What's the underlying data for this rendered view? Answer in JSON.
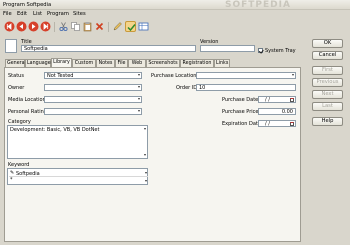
{
  "window": {
    "title": "Program Softpedia"
  },
  "menu": [
    "File",
    "Edit",
    "List",
    "Program",
    "Sites"
  ],
  "toolbar": {
    "icons": [
      "nav-first-icon",
      "nav-prev-icon",
      "nav-next-icon",
      "nav-last-icon",
      "cut-icon",
      "copy-icon",
      "paste-icon",
      "delete-icon",
      "edit-icon",
      "check-icon",
      "grid-icon"
    ]
  },
  "header": {
    "title_label": "Title",
    "title_value": "Softpedia",
    "version_label": "Version",
    "version_value": "",
    "system_tray_label": "System Tray",
    "system_tray_checked": true
  },
  "tabs": [
    "General",
    "Language",
    "Library",
    "Custom",
    "Notes",
    "File",
    "Web",
    "Screenshots",
    "Registration",
    "Links"
  ],
  "active_tab": "Library",
  "library": {
    "status_label": "Status",
    "status_value": "Not Tested",
    "owner_label": "Owner",
    "owner_value": "",
    "media_location_label": "Media Location",
    "media_location_value": "",
    "personal_rating_label": "Personal Rating",
    "personal_rating_value": "",
    "purchase_location_label": "Purchase Location",
    "purchase_location_value": "",
    "order_id_label": "Order ID",
    "order_id_value": "10",
    "purchase_date_label": "Purchase Date",
    "purchase_date_value": "/ /",
    "purchase_price_label": "Purchase Price",
    "purchase_price_value": "0.00",
    "expiration_date_label": "Expiration Date",
    "expiration_date_value": "/ /",
    "category_label": "Category",
    "category_value": "Development: Basic, VB, VB DotNet",
    "keyword_label": "Keyword",
    "keywords": [
      "Softpedia",
      ""
    ]
  },
  "buttons": {
    "ok": "OK",
    "cancel": "Cancel",
    "first": "First",
    "previous": "Previous",
    "next": "Next",
    "last": "Last",
    "help": "Help"
  },
  "watermark": "SOFTPEDIA"
}
